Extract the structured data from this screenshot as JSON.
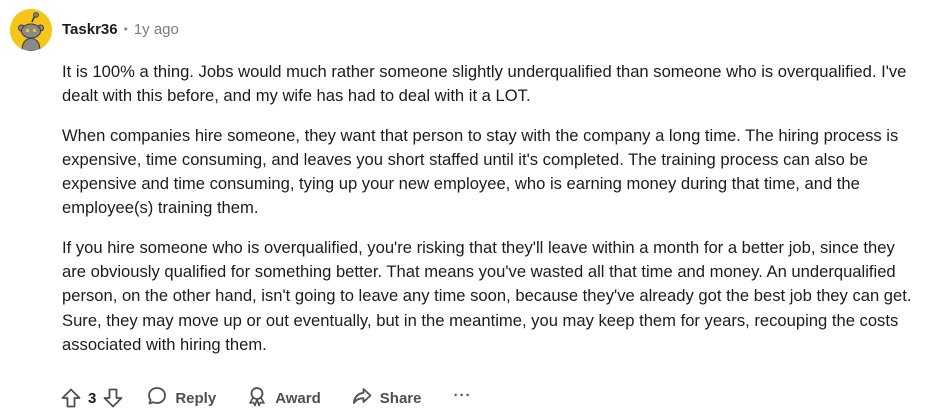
{
  "comment": {
    "author": "Taskr36",
    "separator": "•",
    "age": "1y ago",
    "paragraphs": [
      "It is 100% a thing. Jobs would much rather someone slightly underqualified than someone who is overqualified. I've dealt with this before, and my wife has had to deal with it a LOT.",
      "When companies hire someone, they want that person to stay with the company a long time. The hiring process is expensive, time consuming, and leaves you short staffed until it's completed. The training process can also be expensive and time consuming, tying up your new employee, who is earning money during that time, and the employee(s) training them.",
      "If you hire someone who is overqualified, you're risking that they'll leave within a month for a better job, since they are obviously qualified for something better. That means you've wasted all that time and money. An underqualified person, on the other hand, isn't going to leave any time soon, because they've already got the best job they can get. Sure, they may move up or out eventually, but in the meantime, you may keep them for years, recouping the costs associated with hiring them."
    ]
  },
  "actions": {
    "score": "3",
    "reply_label": "Reply",
    "award_label": "Award",
    "share_label": "Share",
    "more_label": "···"
  },
  "icons": {
    "avatar": "snoo-avatar-icon",
    "upvote": "upvote-arrow-icon",
    "downvote": "downvote-arrow-icon",
    "reply": "speech-bubble-icon",
    "award": "award-ribbon-icon",
    "share": "share-arrow-icon"
  },
  "colors": {
    "avatar_bg": "#f5c518",
    "text": "#1c1c1c",
    "meta": "#787c7e",
    "action": "#4f4f4f"
  }
}
